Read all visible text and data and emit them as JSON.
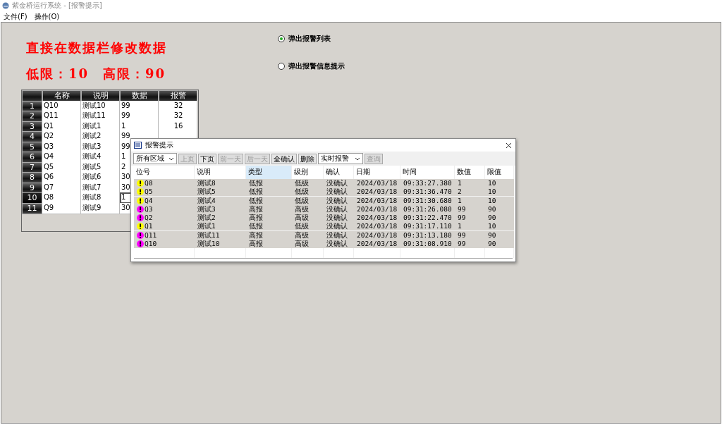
{
  "window": {
    "title": "紫金桥运行系统 - [报警提示]"
  },
  "menu": [
    "文件(F)",
    "操作(O)"
  ],
  "headings": [
    "直接在数据栏修改数据",
    "低限：10　高限：90"
  ],
  "radios": [
    {
      "label": "弹出报警列表",
      "selected": true
    },
    {
      "label": "弹出报警信息提示",
      "selected": false
    }
  ],
  "grid": {
    "columns": [
      "名称",
      "说明",
      "数据",
      "报警"
    ],
    "rows": [
      {
        "index": "1",
        "cells": [
          "Q10",
          "测试10",
          "99",
          "32"
        ],
        "selected": false
      },
      {
        "index": "2",
        "cells": [
          "Q11",
          "测试11",
          "99",
          "32"
        ],
        "selected": false
      },
      {
        "index": "3",
        "cells": [
          "Q1",
          "测试1",
          "1",
          "16"
        ],
        "selected": false
      },
      {
        "index": "4",
        "cells": [
          "Q2",
          "测试2",
          "99"
        ],
        "selected": false
      },
      {
        "index": "5",
        "cells": [
          "Q3",
          "测试3",
          "99"
        ],
        "selected": false
      },
      {
        "index": "6",
        "cells": [
          "Q4",
          "测试4",
          "1"
        ],
        "selected": false
      },
      {
        "index": "7",
        "cells": [
          "Q5",
          "测试5",
          "2"
        ],
        "selected": false
      },
      {
        "index": "8",
        "cells": [
          "Q6",
          "测试6",
          "30"
        ],
        "selected": false
      },
      {
        "index": "9",
        "cells": [
          "Q7",
          "测试7",
          "30"
        ],
        "selected": false
      },
      {
        "index": "10",
        "cells": [
          "Q8",
          "测试8",
          "1"
        ],
        "selected": true
      },
      {
        "index": "11",
        "cells": [
          "Q9",
          "测试9",
          "30"
        ],
        "selected": false
      }
    ]
  },
  "dialog": {
    "title": "报警提示",
    "toolbar": [
      {
        "kind": "select",
        "label": "所有区域",
        "disabled": false
      },
      {
        "kind": "button",
        "label": "上页",
        "disabled": true
      },
      {
        "kind": "button",
        "label": "下页",
        "disabled": false
      },
      {
        "kind": "button",
        "label": "前一天",
        "disabled": true
      },
      {
        "kind": "button",
        "label": "后一天",
        "disabled": true
      },
      {
        "kind": "button",
        "label": "全确认",
        "disabled": false
      },
      {
        "kind": "button",
        "label": "删除",
        "disabled": false
      },
      {
        "kind": "select",
        "label": "实时报警",
        "disabled": false
      },
      {
        "kind": "button",
        "label": "查询",
        "disabled": true
      }
    ],
    "columns": [
      {
        "label": "位号",
        "selected": false
      },
      {
        "label": "说明",
        "selected": false
      },
      {
        "label": "类型",
        "selected": true
      },
      {
        "label": "级别",
        "selected": false
      },
      {
        "label": "确认",
        "selected": false
      },
      {
        "label": "日期",
        "selected": false
      },
      {
        "label": "时间",
        "selected": false
      },
      {
        "label": "数值",
        "selected": false
      },
      {
        "label": "限值",
        "selected": false
      }
    ],
    "rows": [
      {
        "color": "#ffff00",
        "cells": [
          "Q8",
          "测试8",
          "低报",
          "低级",
          "没确认",
          "2024/03/18",
          "09:33:27.380",
          "1",
          "10"
        ]
      },
      {
        "color": "#ffff00",
        "cells": [
          "Q5",
          "测试5",
          "低报",
          "低级",
          "没确认",
          "2024/03/18",
          "09:31:36.470",
          "2",
          "10"
        ]
      },
      {
        "color": "#ffff00",
        "cells": [
          "Q4",
          "测试4",
          "低报",
          "低级",
          "没确认",
          "2024/03/18",
          "09:31:30.680",
          "1",
          "10"
        ]
      },
      {
        "color": "#ff00ff",
        "cells": [
          "Q3",
          "测试3",
          "高报",
          "高级",
          "没确认",
          "2024/03/18",
          "09:31:26.080",
          "99",
          "90"
        ]
      },
      {
        "color": "#ff00ff",
        "cells": [
          "Q2",
          "测试2",
          "高报",
          "高级",
          "没确认",
          "2024/03/18",
          "09:31:22.470",
          "99",
          "90"
        ]
      },
      {
        "color": "#ffff00",
        "cells": [
          "Q1",
          "测试1",
          "低报",
          "低级",
          "没确认",
          "2024/03/18",
          "09:31:17.110",
          "1",
          "10"
        ]
      },
      {
        "color": "#ff00ff",
        "cells": [
          "Q11",
          "测试11",
          "高报",
          "高级",
          "没确认",
          "2024/03/18",
          "09:31:13.180",
          "99",
          "90"
        ]
      },
      {
        "color": "#ff00ff",
        "cells": [
          "Q10",
          "测试10",
          "高报",
          "高级",
          "没确认",
          "2024/03/18",
          "09:31:08.910",
          "99",
          "90"
        ]
      }
    ]
  }
}
